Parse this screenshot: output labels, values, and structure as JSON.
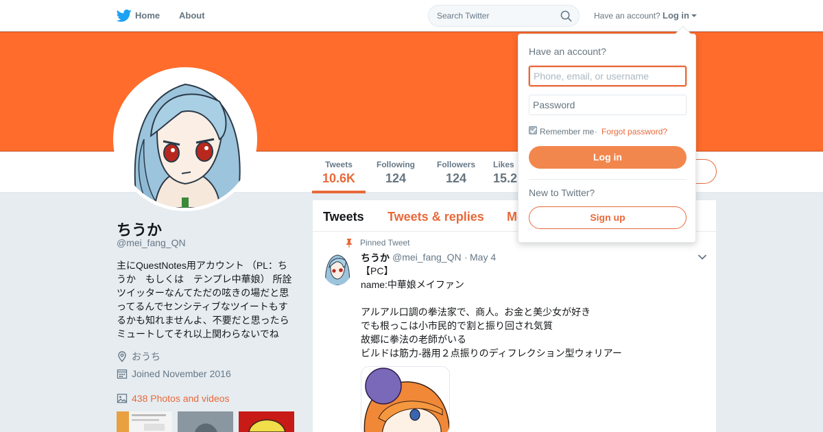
{
  "colors": {
    "accent": "#e8693a",
    "banner": "#ff6c2c",
    "background": "#e6ecf0",
    "twitter_blue": "#1da1f2"
  },
  "topbar": {
    "logo_icon": "twitter-bird-icon",
    "home_label": "Home",
    "about_label": "About",
    "search_placeholder": "Search Twitter",
    "search_icon": "search-icon",
    "have_account": "Have an account?",
    "login_label": "Log in"
  },
  "profile_nav": {
    "stats": [
      {
        "label": "Tweets",
        "value": "10.6K"
      },
      {
        "label": "Following",
        "value": "124"
      },
      {
        "label": "Followers",
        "value": "124"
      },
      {
        "label": "Likes",
        "value": "15.2K"
      }
    ]
  },
  "profile": {
    "name": "ちうか",
    "handle": "@mei_fang_QN",
    "bio": "主にQuestNotes用アカウント （PL：ちうか　もしくは　テンプレ中華娘） 所詮ツイッターなんてただの呟きの場だと思ってるんでセンシティブなツイートもするかも知れませんよ、不要だと思ったらミュートしてそれ以上関わらないでね",
    "location": "おうち",
    "joined": "Joined November 2016",
    "photos": "438 Photos and videos"
  },
  "timeline": {
    "tabs": [
      "Tweets",
      "Tweets & replies",
      "Media"
    ],
    "pinned_label": "Pinned Tweet",
    "tweet": {
      "name": "ちうか",
      "handle": "@mei_fang_QN",
      "dot": "·",
      "date": "May 4",
      "text": "【PC】\nname:中華娘メイファン\n\nアルアル口調の拳法家で、商人。お金と美少女が好き\nでも根っこは小市民的で割と振り回され気質\n故郷に拳法の老師がいる\nビルドは筋力-器用２点振りのディフレクション型ウォリアー"
    }
  },
  "login_dropdown": {
    "title": "Have an account?",
    "username_placeholder": "Phone, email, or username",
    "password_placeholder": "Password",
    "remember_label": "Remember me",
    "separator": "·",
    "forgot_label": "Forgot password?",
    "login_button": "Log in",
    "new_to": "New to Twitter?",
    "signup_button": "Sign up"
  }
}
